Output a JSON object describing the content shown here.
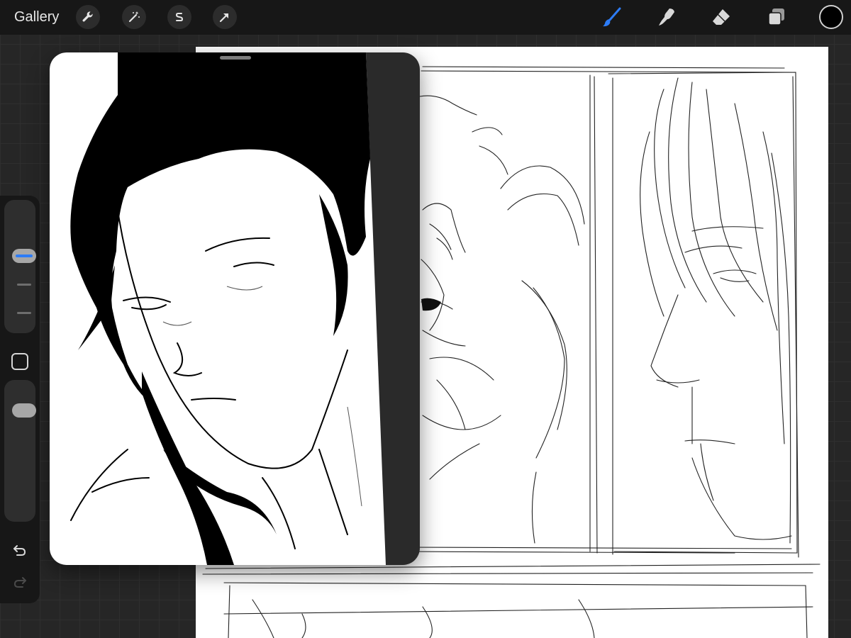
{
  "topbar": {
    "gallery_label": "Gallery",
    "actions_icon": "wrench-icon",
    "adjustments_icon": "magic-wand-icon",
    "selection_icon": "selection-s-icon",
    "transform_icon": "arrow-cursor-icon",
    "brush_icon": "brush-icon",
    "smudge_icon": "smudge-icon",
    "eraser_icon": "eraser-icon",
    "layers_icon": "layers-icon",
    "active_tool": "brush",
    "current_color": "#000000",
    "active_tool_color": "#2d7cf6"
  },
  "sidebar": {
    "brush_size_level": 0.6,
    "brush_opacity_level": 0.85,
    "modify_icon": "square-icon",
    "undo_icon": "undo-arrow-icon",
    "redo_icon": "redo-arrow-icon",
    "redo_enabled": false
  },
  "reference_window": {
    "content": "reference-image"
  },
  "colors": {
    "toolbar_bg": "#171717",
    "workspace_bg": "#262626",
    "canvas_bg": "#ffffff",
    "accent": "#2d7cf6"
  }
}
